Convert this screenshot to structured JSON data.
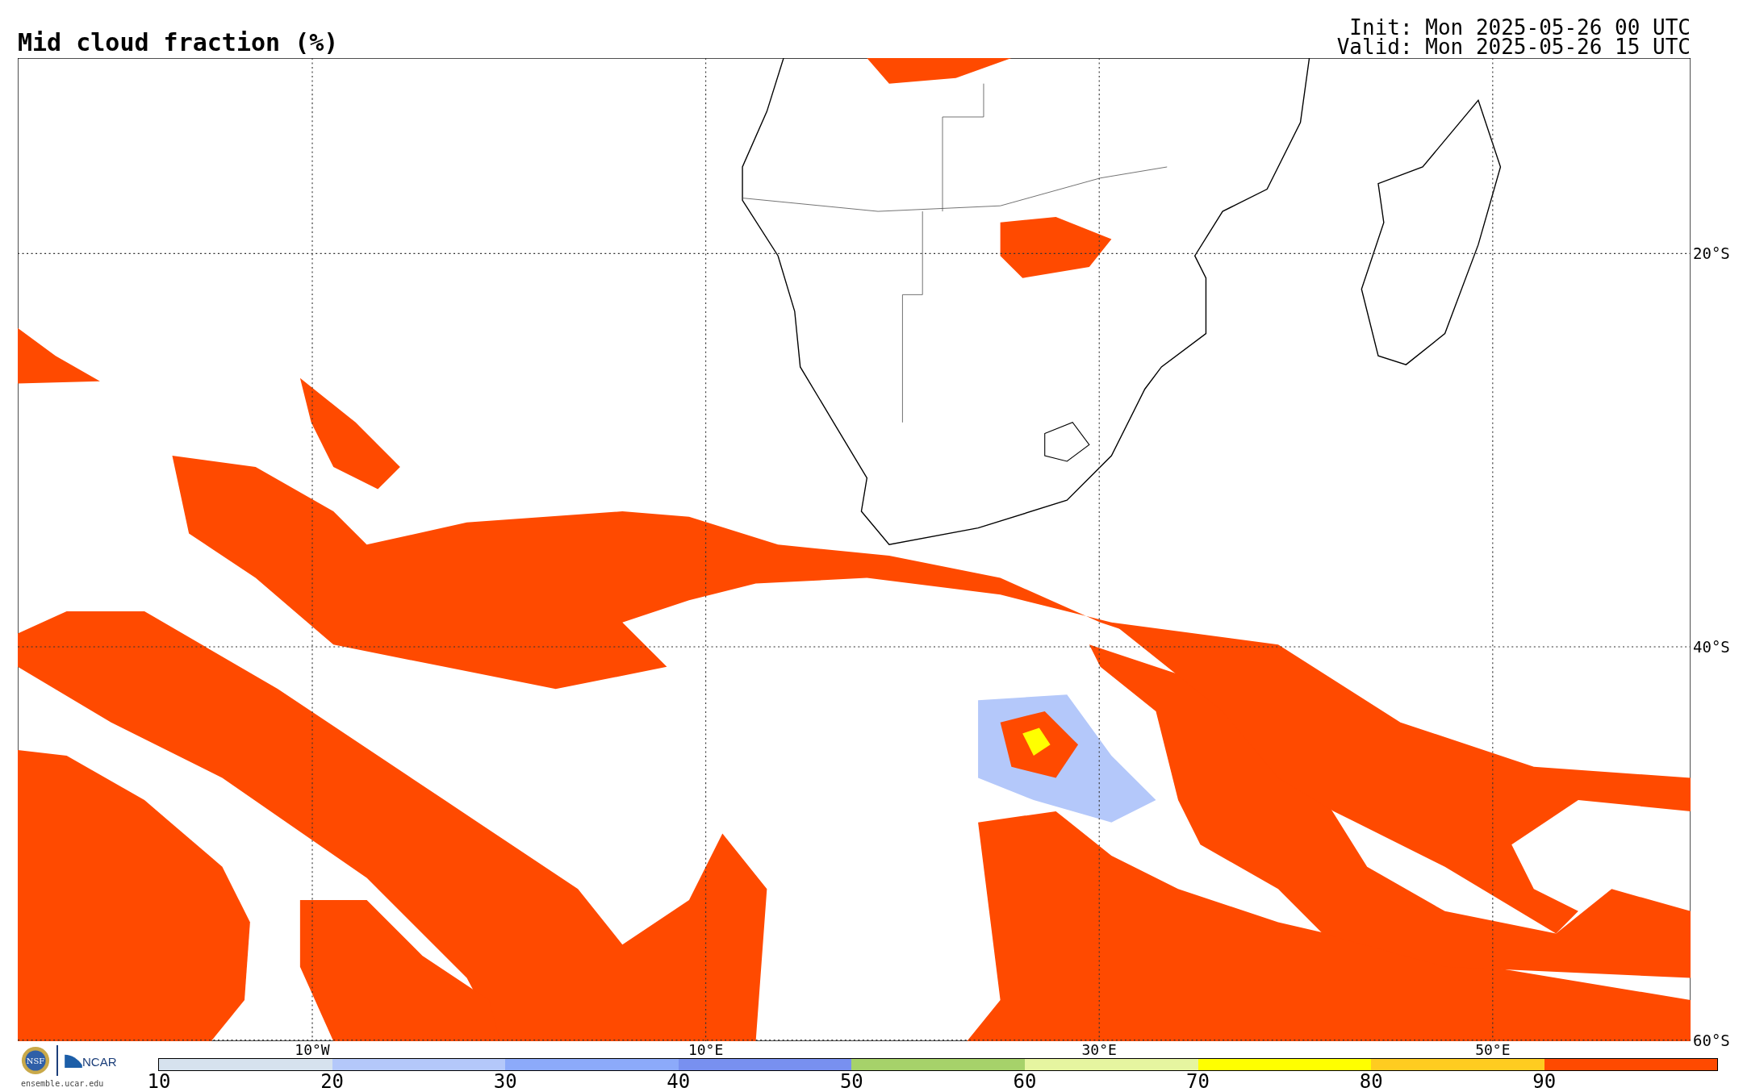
{
  "title": "Mid cloud fraction (%)",
  "run_info": [
    "Init: Mon 2025-05-26 00 UTC",
    "Valid: Mon 2025-05-26 15 UTC"
  ],
  "map": {
    "lat_labels": [
      "20°S",
      "40°S",
      "60°S"
    ],
    "lon_labels": [
      "10°W",
      "10°E",
      "30°E",
      "50°E"
    ]
  },
  "colorbar": {
    "segments": [
      {
        "color": "#d6e2ee",
        "label": "10"
      },
      {
        "color": "#b4c8fa",
        "label": "20"
      },
      {
        "color": "#8caafa",
        "label": "30"
      },
      {
        "color": "#7890f0",
        "label": "40"
      },
      {
        "color": "#a6d26a",
        "label": "50"
      },
      {
        "color": "#e6f5a0",
        "label": "60"
      },
      {
        "color": "#ffff00",
        "label": "70"
      },
      {
        "color": "#ffcc20",
        "label": "80"
      },
      {
        "color": "#ff4a00",
        "label": "90"
      }
    ]
  },
  "credits": {
    "nsf": "NSF",
    "ncar": "NCAR",
    "url": "ensemble.ucar.edu"
  }
}
